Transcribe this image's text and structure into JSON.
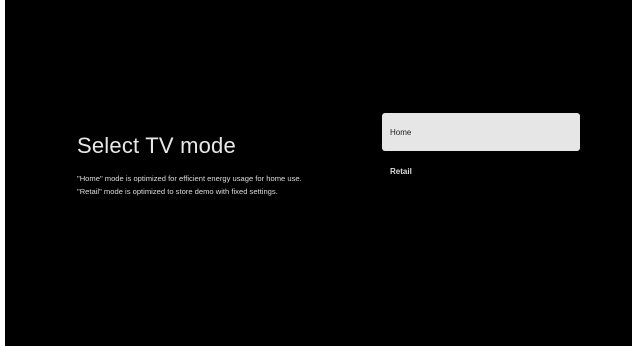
{
  "screen": {
    "title": "Select TV mode",
    "description_lines": [
      "\"Home\" mode is optimized for efficient energy usage for home use.",
      "\"Retail\" mode is optimized to store demo with fixed settings."
    ]
  },
  "options": [
    {
      "label": "Home",
      "selected": true
    },
    {
      "label": "Retail",
      "selected": false
    }
  ],
  "colors": {
    "background": "#000000",
    "selected_bg": "#e6e6e6",
    "text": "#dcdcdc"
  }
}
